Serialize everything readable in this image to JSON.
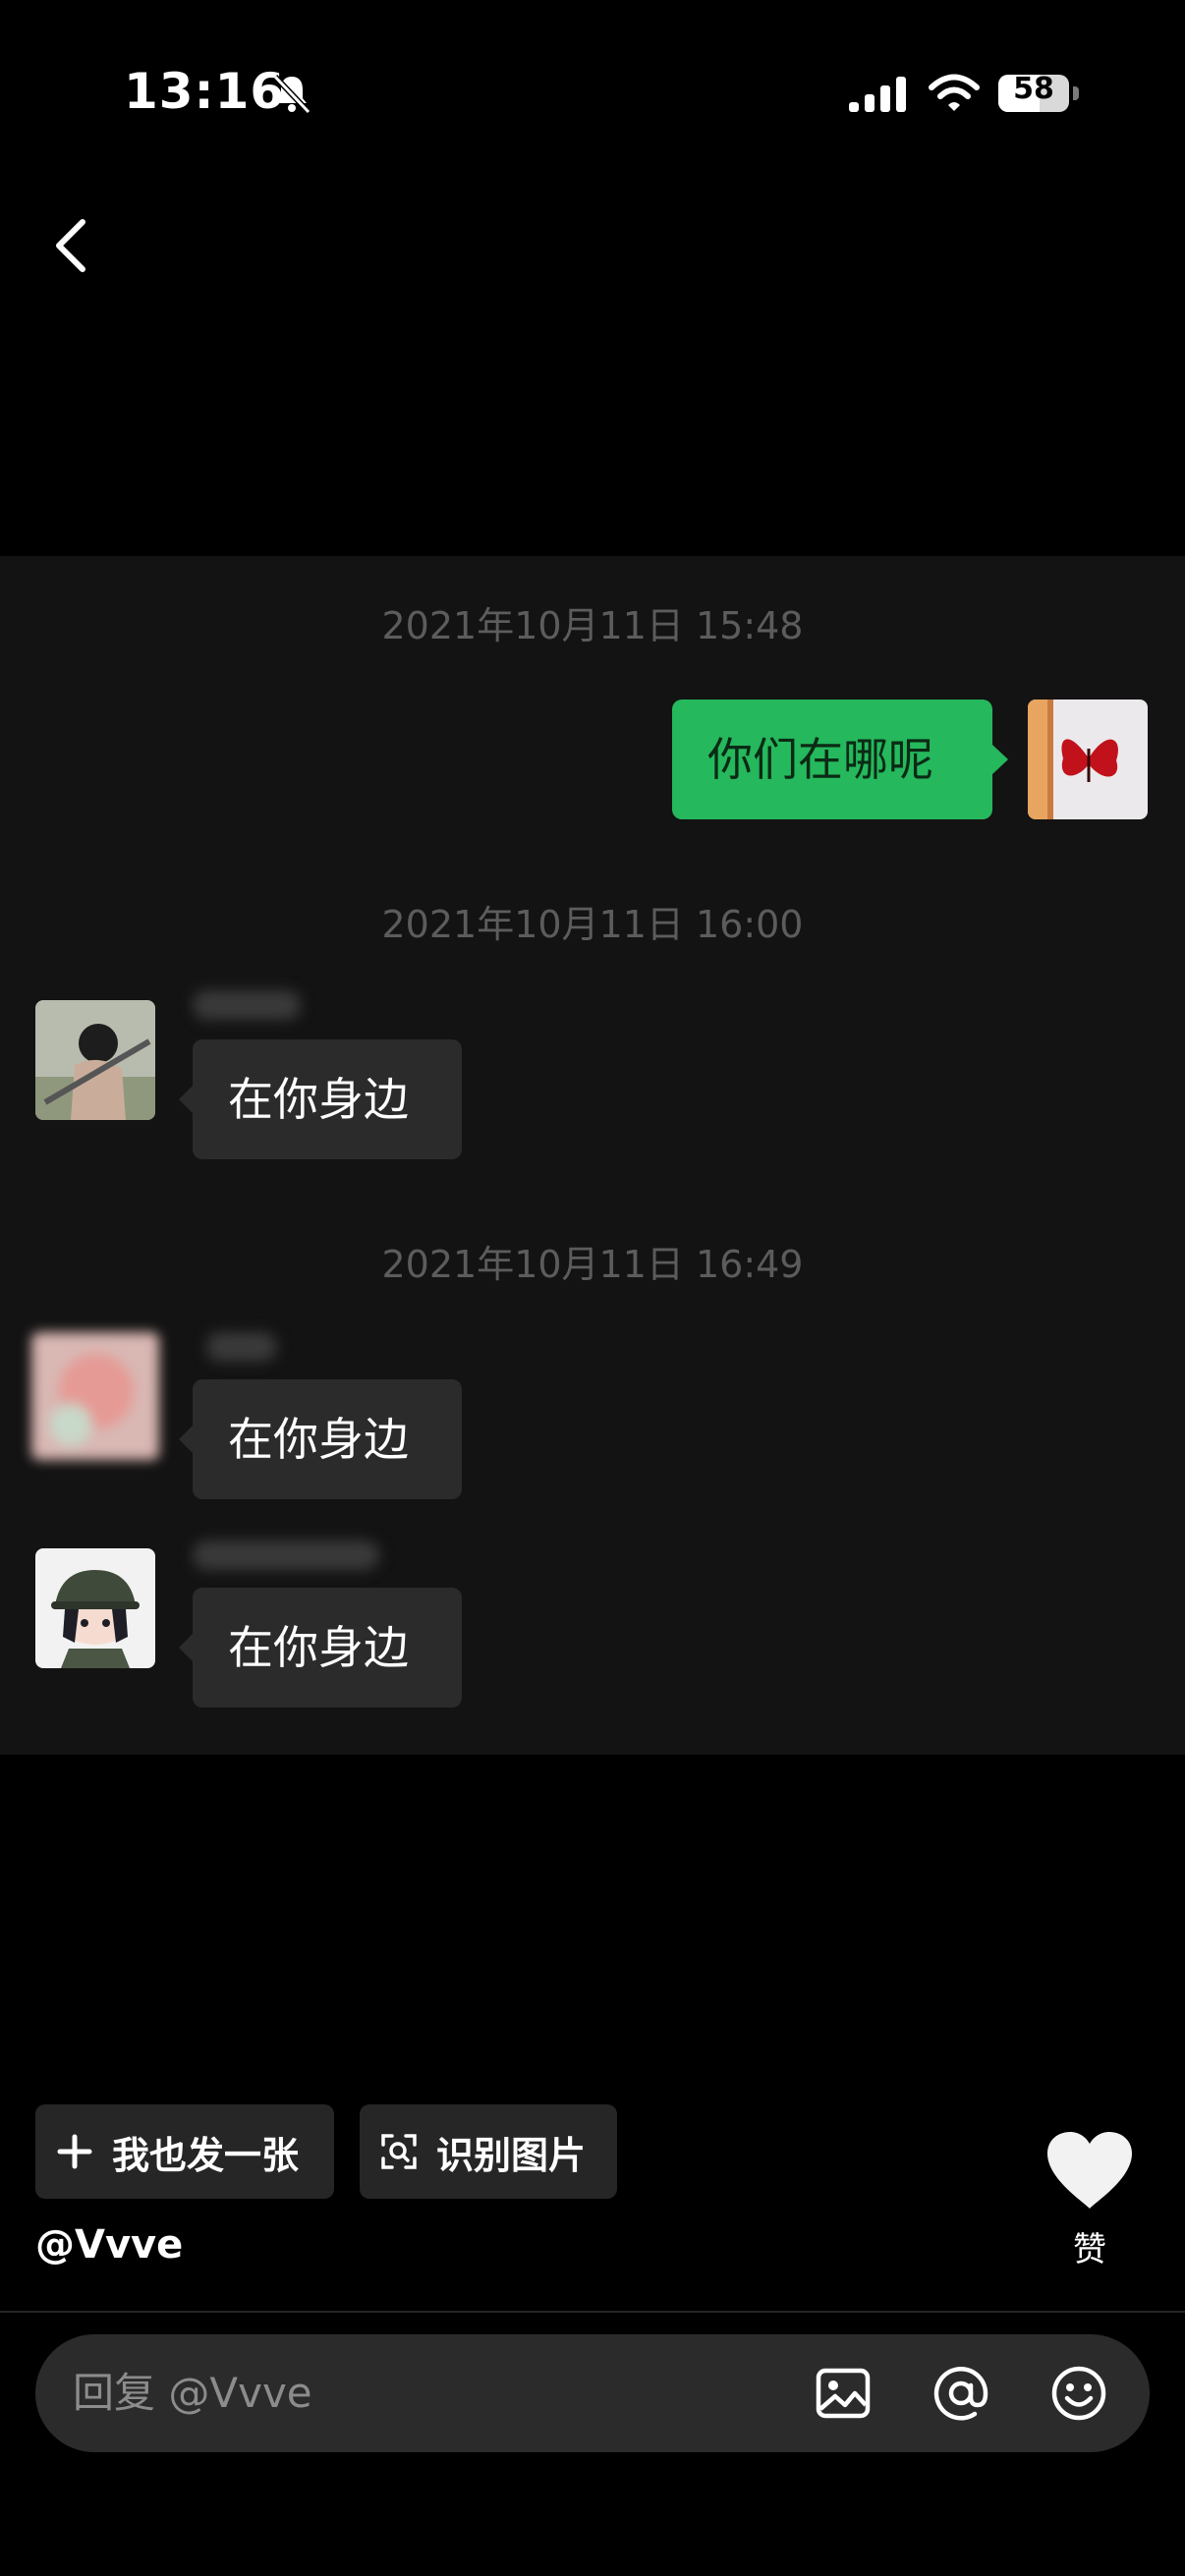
{
  "status_bar": {
    "time": "13:16",
    "battery": "58",
    "battery_level": 0.58,
    "icons": [
      "bell-muted-icon",
      "cellular-signal-icon",
      "wifi-icon",
      "battery-icon"
    ]
  },
  "nav": {
    "back_icon": "chevron-left-icon"
  },
  "chat": {
    "timestamps": [
      "2021年10月11日 15:48",
      "2021年10月11日 16:00",
      "2021年10月11日 16:49"
    ],
    "messages": [
      {
        "direction": "outgoing",
        "text": "你们在哪呢"
      },
      {
        "direction": "incoming",
        "text": "在你身边"
      },
      {
        "direction": "incoming",
        "text": "在你身边"
      },
      {
        "direction": "incoming",
        "text": "在你身边"
      }
    ]
  },
  "actions": {
    "post_label": "我也发一张",
    "post_icon": "plus-icon",
    "recognize_label": "识别图片",
    "recognize_icon": "scan-icon"
  },
  "like": {
    "label": "赞",
    "icon": "heart-icon"
  },
  "author": "@Vvve",
  "reply": {
    "placeholder": "回复 @Vvve",
    "icons": [
      "image-icon",
      "at-icon",
      "emoji-icon"
    ]
  },
  "colors": {
    "background": "#000000",
    "card": "#131313",
    "outgoing_bubble": "#25b85c",
    "incoming_bubble": "#2b2b2b"
  }
}
